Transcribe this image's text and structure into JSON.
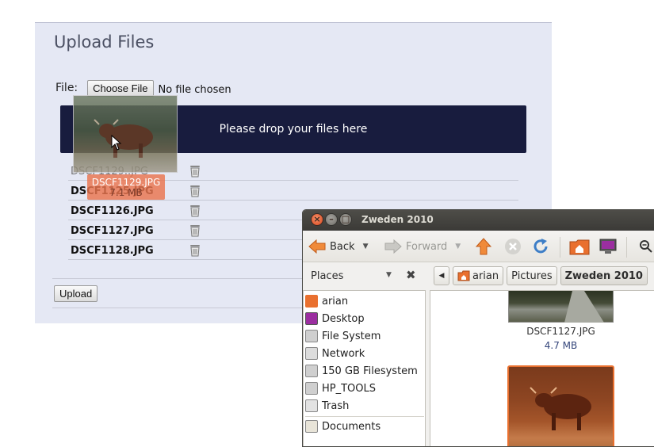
{
  "upload": {
    "title": "Upload Files",
    "file_label": "File:",
    "choose_button": "Choose File",
    "no_file_text": "No file chosen",
    "drop_text": "Please drop your files here",
    "files": [
      {
        "name": "DSCF1129..JPG"
      },
      {
        "name": "DSCF1125.JPG"
      },
      {
        "name": "DSCF1126.JPG"
      },
      {
        "name": "DSCF1127.JPG"
      },
      {
        "name": "DSCF1128.JPG"
      }
    ],
    "upload_button": "Upload"
  },
  "drag": {
    "label_name": "DSCF1129.JPG",
    "label_size": "7.1 MB"
  },
  "file_manager": {
    "window_title": "Zweden 2010",
    "toolbar": {
      "back": "Back",
      "forward": "Forward"
    },
    "places_label": "Places",
    "path": [
      "arian",
      "Pictures",
      "Zweden 2010"
    ],
    "sidebar": [
      {
        "label": "arian",
        "icon": "home-folder-icon"
      },
      {
        "label": "Desktop",
        "icon": "desktop-icon"
      },
      {
        "label": "File System",
        "icon": "drive-icon"
      },
      {
        "label": "Network",
        "icon": "network-icon"
      },
      {
        "label": "150 GB Filesystem",
        "icon": "drive-icon"
      },
      {
        "label": "HP_TOOLS",
        "icon": "drive-icon"
      },
      {
        "label": "Trash",
        "icon": "trash-icon"
      },
      {
        "label": "Documents",
        "icon": "folder-icon"
      }
    ],
    "items": [
      {
        "name": "DSCF1127.JPG",
        "size": "4.7 MB"
      },
      {
        "name": "",
        "size": ""
      }
    ]
  },
  "colors": {
    "drop_zone": "#181c3e",
    "accent_orange": "#e9702f",
    "panel_bg": "#e5e8f4"
  }
}
